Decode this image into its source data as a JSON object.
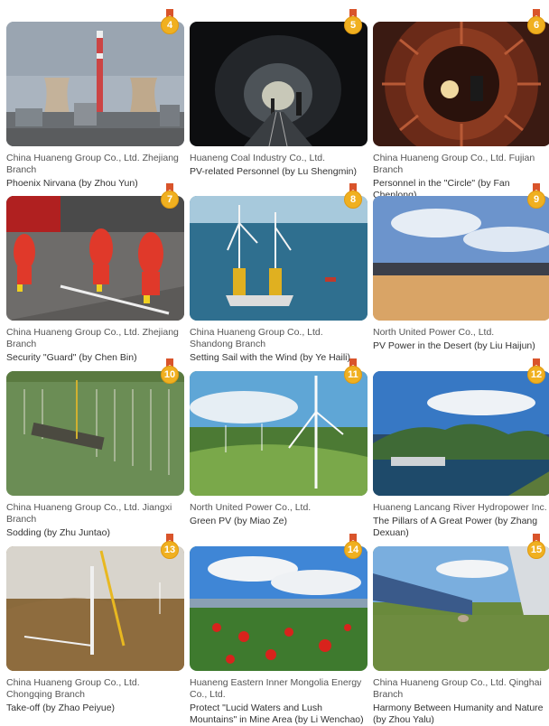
{
  "cards": [
    {
      "rank": "4",
      "company": "China Huaneng Group Co., Ltd. Zhejiang Branch",
      "title": "Phoenix Nirvana (by Zhou Yun)",
      "scene": "power-plant-cooling-towers"
    },
    {
      "rank": "5",
      "company": "Huaneng Coal Industry Co., Ltd.",
      "title": "PV-related Personnel (by Lu Shengmin)",
      "scene": "mine-tunnel"
    },
    {
      "rank": "6",
      "company": "China Huaneng Group Co., Ltd. Fujian Branch",
      "title": "Personnel in the \"Circle\" (by Fan Chenlong)",
      "scene": "generator-stator-interior"
    },
    {
      "rank": "7",
      "company": "China Huaneng Group Co., Ltd. Zhejiang Branch",
      "title": "Security \"Guard\" (by Chen Bin)",
      "scene": "firefighters-running"
    },
    {
      "rank": "8",
      "company": "China Huaneng Group Co., Ltd. Shandong Branch",
      "title": "Setting Sail with the Wind (by Ye Haili)",
      "scene": "offshore-wind-installation"
    },
    {
      "rank": "9",
      "company": "North United Power Co., Ltd.",
      "title": "PV Power in the Desert (by Liu Haijun)",
      "scene": "desert-pv-field"
    },
    {
      "rank": "10",
      "company": "China Huaneng Group Co., Ltd. Jiangxi Branch",
      "title": "Sodding (by Zhu Juntao)",
      "scene": "pv-on-water"
    },
    {
      "rank": "11",
      "company": "North United Power Co., Ltd.",
      "title": "Green PV (by Miao Ze)",
      "scene": "wind-turbines-green-field"
    },
    {
      "rank": "12",
      "company": "Huaneng Lancang River Hydropower Inc.",
      "title": "The Pillars of A Great Power (by Zhang Dexuan)",
      "scene": "hydropower-dam-lake"
    },
    {
      "rank": "13",
      "company": "China Huaneng Group Co., Ltd. Chongqing Branch",
      "title": "Take-off (by Zhao Peiyue)",
      "scene": "wind-turbine-crane"
    },
    {
      "rank": "14",
      "company": "Huaneng Eastern Inner Mongolia Energy Co., Ltd.",
      "title": "Protect \"Lucid Waters and Lush Mountains\" in Mine Area (by Li Wenchao)",
      "scene": "red-flowers-mine-area"
    },
    {
      "rank": "15",
      "company": "China Huaneng Group Co., Ltd. Qinghai Branch",
      "title": "Harmony Between Humanity and Nature (by Zhou Yalu)",
      "scene": "solar-panels-grassland"
    }
  ],
  "colors": {
    "medal": "#f0b020",
    "ribbon": "#d9542b",
    "caption": "#555555"
  }
}
